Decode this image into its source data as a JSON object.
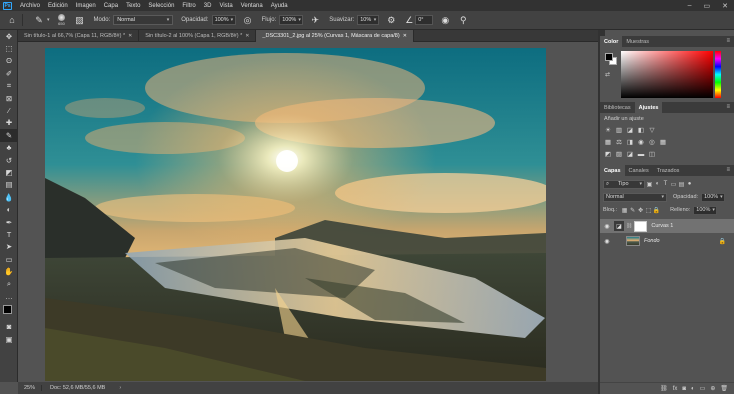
{
  "app": {
    "logo_text": "Ps"
  },
  "menu": [
    "Archivo",
    "Edición",
    "Imagen",
    "Capa",
    "Texto",
    "Selección",
    "Filtro",
    "3D",
    "Vista",
    "Ventana",
    "Ayuda"
  ],
  "window_controls": [
    "–",
    "▭",
    "✕"
  ],
  "options": {
    "brush_size": "650",
    "mode_label": "Modo:",
    "mode_value": "Normal",
    "opacity_label": "Opacidad:",
    "opacity_value": "100%",
    "flow_label": "Flujo:",
    "flow_value": "100%",
    "smoothing_label": "Suavizar:",
    "smoothing_value": "10%",
    "angle_value": "0°"
  },
  "document_tabs": [
    {
      "label": "Sin título-1 al 66,7% (Capa 11, RGB/8#) *",
      "active": false
    },
    {
      "label": "Sin título-2 al 100% (Capa 1, RGB/8#) *",
      "active": false
    },
    {
      "label": "_DSC3301_2.jpg al 25% (Curvas 1, Máscara de capa/8)",
      "active": true
    }
  ],
  "status": {
    "zoom": "25%",
    "doc": "Doc: 52,6 MB/55,6 MB"
  },
  "color_panel": {
    "tabs": [
      "Color",
      "Muestras"
    ]
  },
  "adjust_panel": {
    "tabs": [
      "Bibliotecas",
      "Ajustes"
    ],
    "title": "Añadir un ajuste"
  },
  "layers_panel": {
    "tabs": [
      "Capas",
      "Canales",
      "Trazados"
    ],
    "filter_value": "Tipo",
    "blend_value": "Normal",
    "opacity_label": "Opacidad:",
    "opacity_value": "100%",
    "lock_label": "Bloq.:",
    "fill_label": "Relleno:",
    "fill_value": "100%",
    "layers": [
      {
        "name": "Curvas 1",
        "selected": true,
        "type": "adjustment"
      },
      {
        "name": "Fondo",
        "selected": false,
        "type": "image",
        "locked": true
      }
    ]
  },
  "colors": {
    "accent": "#31a8ff",
    "fg": "#000000",
    "bg": "#ffffff"
  }
}
